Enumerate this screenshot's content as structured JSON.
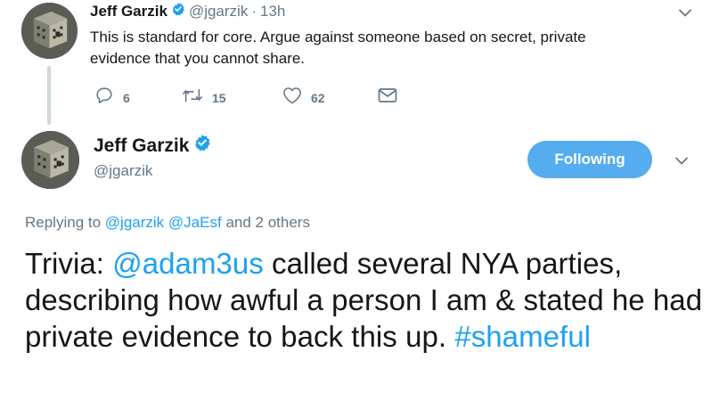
{
  "parent_tweet": {
    "author_name": "Jeff Garzik",
    "author_handle": "@jgarzik",
    "separator": "·",
    "time": "13h",
    "text": "This is standard for core. Argue against someone based on secret, private evidence that you cannot share.",
    "avatar_icon": "sponge-cube-avatar",
    "actions": {
      "reply_icon": "reply-icon",
      "reply_count": "6",
      "retweet_icon": "retweet-icon",
      "retweet_count": "15",
      "like_icon": "heart-icon",
      "like_count": "62",
      "dm_icon": "envelope-icon"
    }
  },
  "main_tweet": {
    "author_name": "Jeff Garzik",
    "author_handle": "@jgarzik",
    "avatar_icon": "sponge-cube-avatar",
    "follow_button_label": "Following",
    "replying": {
      "prefix": "Replying to",
      "mention_1": "@jgarzik",
      "mention_2": "@JaEsf",
      "suffix": "and 2 others"
    },
    "text": {
      "part_1": "Trivia: ",
      "mention": "@adam3us",
      "part_2": " called several NYA parties, describing how awful a person I am & stated he had private evidence to back this up. ",
      "hashtag": "#shameful"
    }
  },
  "colors": {
    "link_blue": "#1da1f2",
    "follow_button_bg": "#55acee",
    "secondary_text": "#657786",
    "primary_text": "#14171a",
    "thread_line": "#cfd9de"
  }
}
